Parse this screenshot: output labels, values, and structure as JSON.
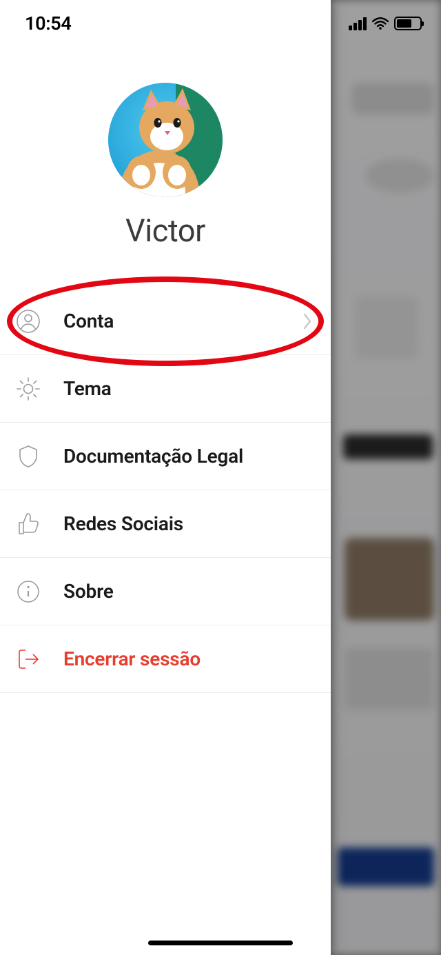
{
  "status": {
    "time": "10:54"
  },
  "profile": {
    "name": "Victor"
  },
  "menu": {
    "account": {
      "label": "Conta"
    },
    "theme": {
      "label": "Tema"
    },
    "legal": {
      "label": "Documentação Legal"
    },
    "social": {
      "label": "Redes Sociais"
    },
    "about": {
      "label": "Sobre"
    },
    "logout": {
      "label": "Encerrar sessão"
    }
  },
  "colors": {
    "accent_red": "#E63D2E",
    "annotation_red": "#E30613"
  }
}
